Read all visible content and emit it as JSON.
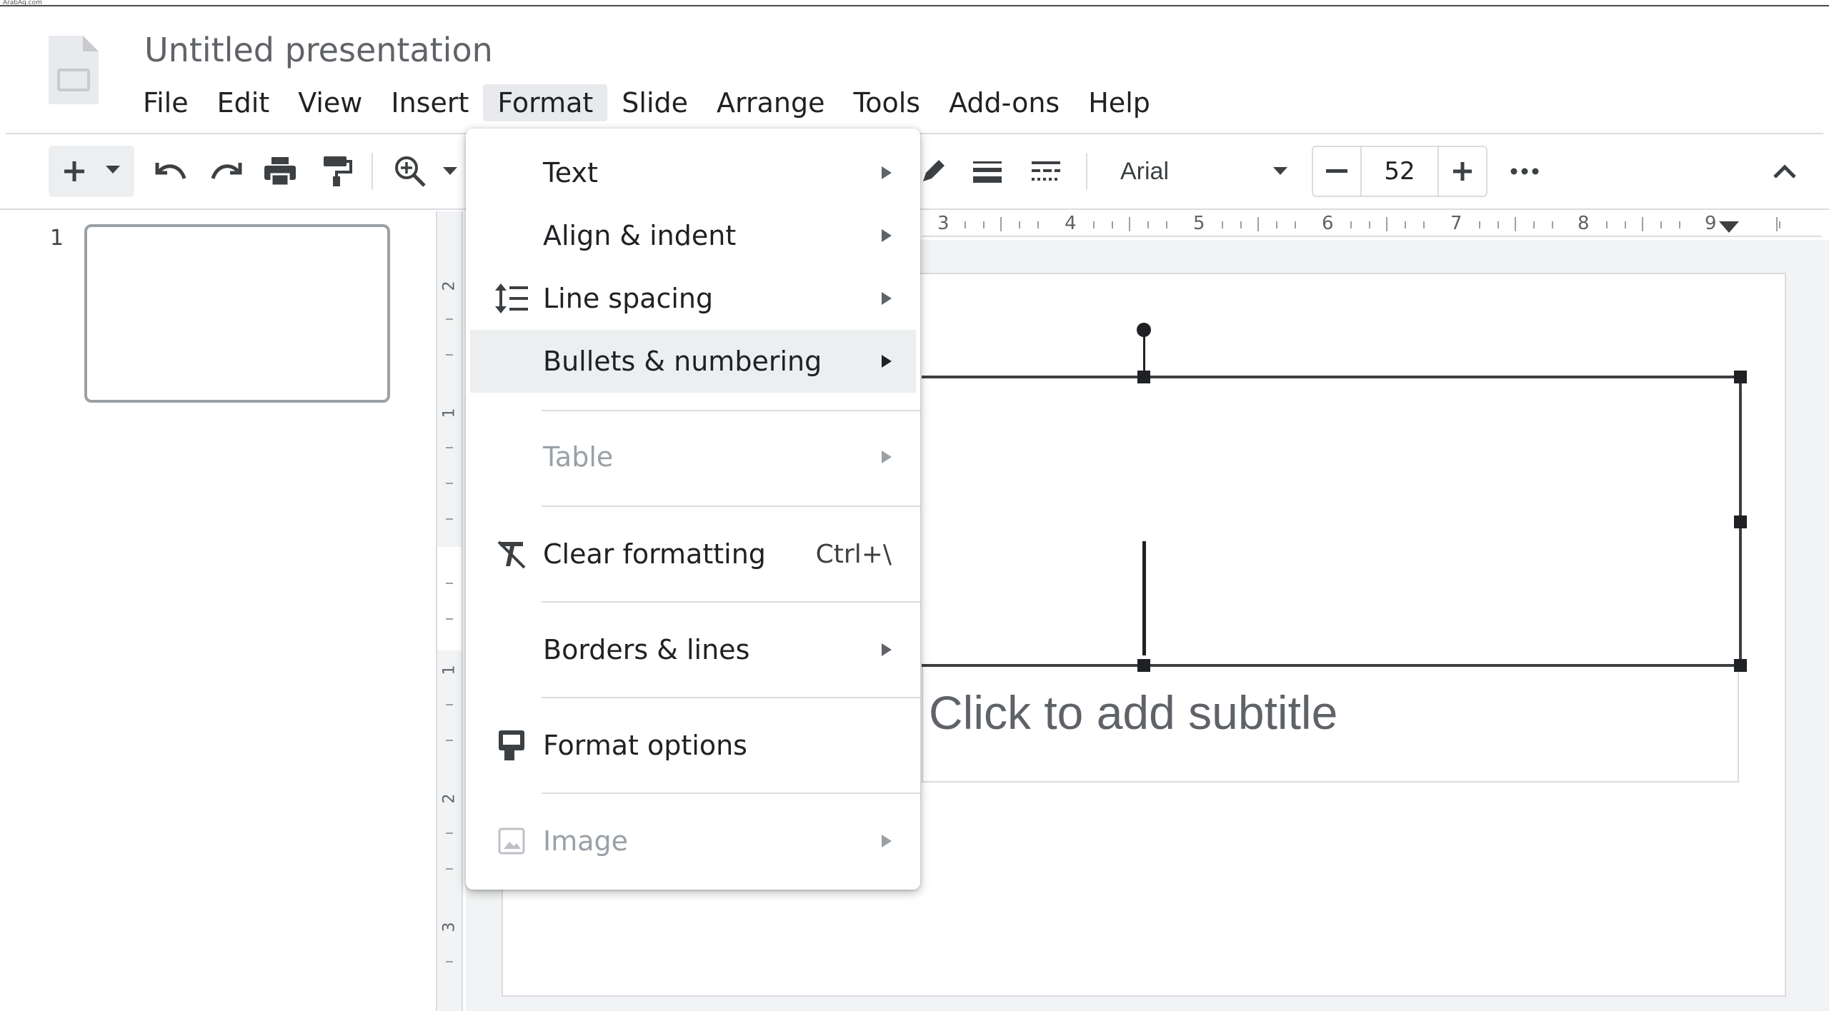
{
  "watermark": "ArabAq.com",
  "document": {
    "title": "Untitled presentation"
  },
  "menubar": {
    "items": [
      "File",
      "Edit",
      "View",
      "Insert",
      "Format",
      "Slide",
      "Arrange",
      "Tools",
      "Add-ons",
      "Help"
    ],
    "open": "Format"
  },
  "toolbar": {
    "font_name": "Arial",
    "font_size": "52",
    "icons": [
      "plus-icon",
      "chevron-down-icon",
      "undo-icon",
      "redo-icon",
      "print-icon",
      "paint-format-icon",
      "zoom-icon",
      "pen-icon",
      "border-weight-icon",
      "border-dash-icon",
      "minus-icon",
      "more-icon",
      "collapse-icon"
    ]
  },
  "filmstrip": {
    "slide_number": "1"
  },
  "rulers": {
    "horizontal": [
      "3",
      "4",
      "5",
      "6",
      "7",
      "8",
      "9"
    ],
    "vertical": [
      "2",
      "1",
      "1",
      "2",
      "3"
    ]
  },
  "slide": {
    "subtitle_placeholder": "Click to add subtitle"
  },
  "format_menu": {
    "items": [
      {
        "label": "Text",
        "submenu": true,
        "icon": ""
      },
      {
        "label": "Align & indent",
        "submenu": true,
        "icon": ""
      },
      {
        "label": "Line spacing",
        "submenu": true,
        "icon": "line-spacing-icon"
      },
      {
        "label": "Bullets & numbering",
        "submenu": true,
        "icon": "",
        "highlighted": true
      },
      {
        "label": "Table",
        "submenu": true,
        "disabled": true
      },
      {
        "label": "Clear formatting",
        "shortcut": "Ctrl+\\",
        "icon": "clear-formatting-icon"
      },
      {
        "label": "Borders & lines",
        "submenu": true
      },
      {
        "label": "Format options",
        "icon": "format-options-icon"
      },
      {
        "label": "Image",
        "submenu": true,
        "disabled": true,
        "icon": "image-icon"
      }
    ]
  },
  "colors": {
    "menu_highlight": "#eceeef",
    "disabled_text": "#9aa0a6",
    "text": "#202124"
  }
}
